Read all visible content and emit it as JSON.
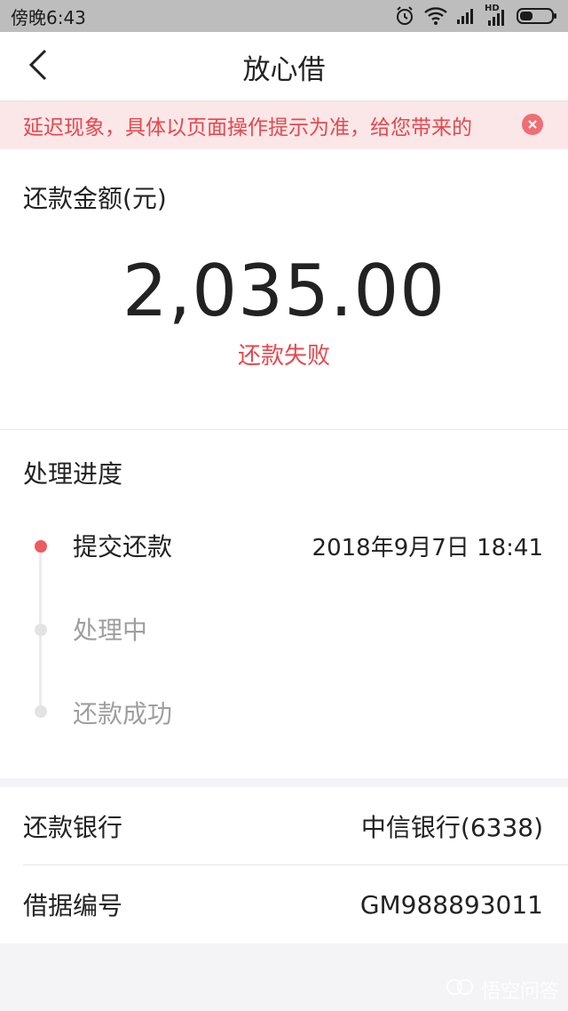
{
  "status_bar": {
    "time": "傍晚6:43",
    "network_label": "HD"
  },
  "nav": {
    "title": "放心借"
  },
  "notice": {
    "text": "延迟现象，具体以页面操作提示为准，给您带来的"
  },
  "amount": {
    "label": "还款金额(元)",
    "value": "2,035.00",
    "status": "还款失败"
  },
  "progress": {
    "title": "处理进度",
    "steps": [
      {
        "label": "提交还款",
        "time": "2018年9月7日 18:41",
        "state": "active"
      },
      {
        "label": "处理中",
        "time": "",
        "state": "pending"
      },
      {
        "label": "还款成功",
        "time": "",
        "state": "pending"
      }
    ]
  },
  "info": {
    "rows": [
      {
        "key": "还款银行",
        "value": "中信银行(6338)"
      },
      {
        "key": "借据编号",
        "value": "GM988893011"
      }
    ]
  },
  "watermark": {
    "text": "悟空问答"
  },
  "colors": {
    "accent_red": "#e5484d",
    "notice_bg": "#fbe7e8",
    "status_bar_bg": "#bdbdbd"
  }
}
